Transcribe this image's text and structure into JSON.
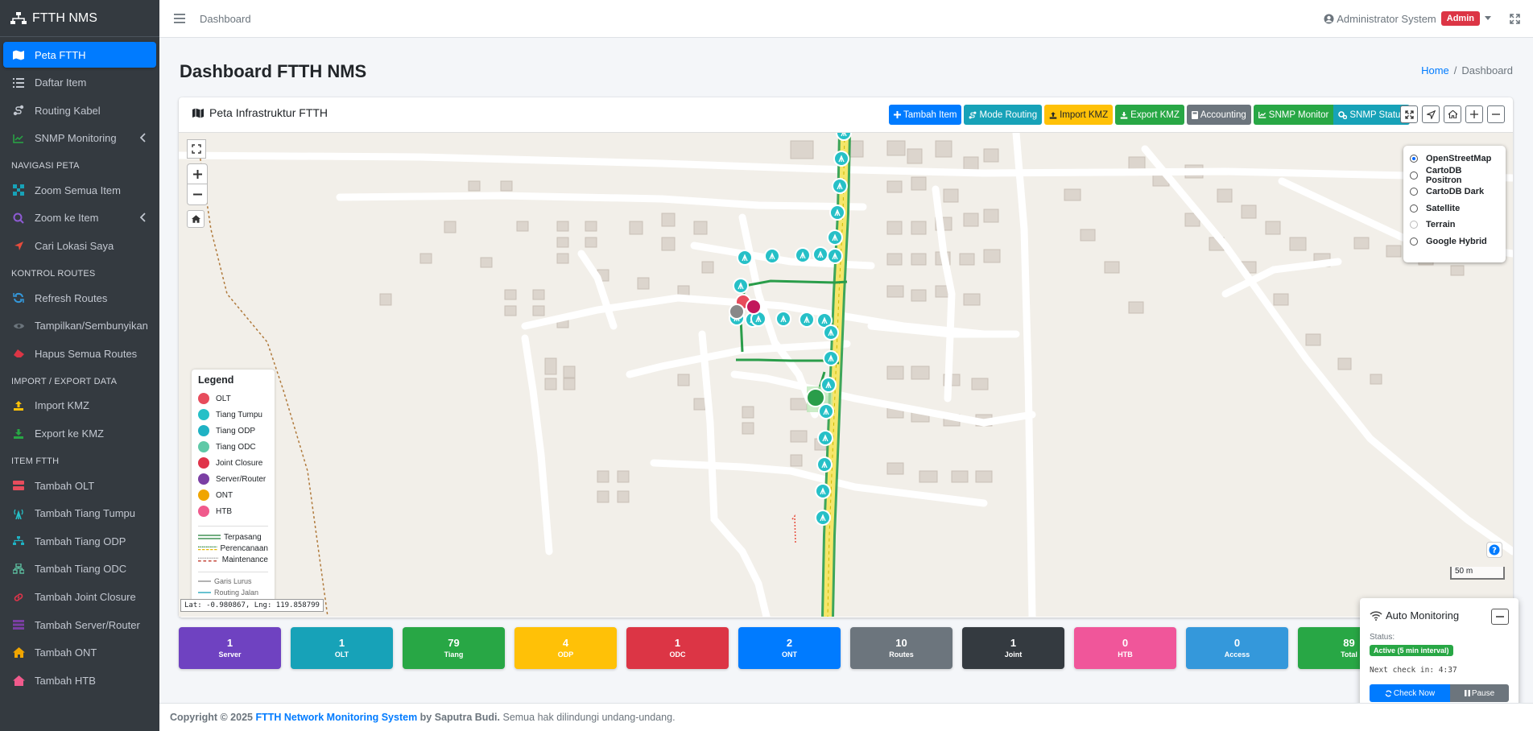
{
  "app": {
    "brand": "FTTH NMS"
  },
  "sidebar": {
    "items": [
      {
        "label": "Peta FTTH",
        "icon": "map-icon",
        "active": true
      },
      {
        "label": "Daftar Item",
        "icon": "list-icon"
      },
      {
        "label": "Routing Kabel",
        "icon": "route-icon"
      },
      {
        "label": "SNMP Monitoring",
        "icon": "chart-line-icon"
      }
    ],
    "header_nav": "NAVIGASI PETA",
    "nav_items": [
      {
        "label": "Zoom Semua Item",
        "icon": "expand-arrows-icon"
      },
      {
        "label": "Zoom ke Item",
        "icon": "search-icon"
      },
      {
        "label": "Cari Lokasi Saya",
        "icon": "location-arrow-icon"
      }
    ],
    "header_routes": "KONTROL ROUTES",
    "route_items": [
      {
        "label": "Refresh Routes",
        "icon": "sync-icon"
      },
      {
        "label": "Tampilkan/Sembunyikan",
        "icon": "eye-icon"
      },
      {
        "label": "Hapus Semua Routes",
        "icon": "eraser-icon"
      }
    ],
    "header_import": "IMPORT / EXPORT DATA",
    "import_items": [
      {
        "label": "Import KMZ",
        "icon": "upload-icon"
      },
      {
        "label": "Export ke KMZ",
        "icon": "download-icon"
      }
    ],
    "header_item": "ITEM FTTH",
    "ftth_items": [
      {
        "label": "Tambah OLT",
        "icon": "server-icon"
      },
      {
        "label": "Tambah Tiang Tumpu",
        "icon": "broadcast-tower-icon"
      },
      {
        "label": "Tambah Tiang ODP",
        "icon": "sitemap-icon"
      },
      {
        "label": "Tambah Tiang ODC",
        "icon": "network-icon"
      },
      {
        "label": "Tambah Joint Closure",
        "icon": "link-icon"
      },
      {
        "label": "Tambah Server/Router",
        "icon": "server-rack-icon"
      },
      {
        "label": "Tambah ONT",
        "icon": "home-icon"
      },
      {
        "label": "Tambah HTB",
        "icon": "house-user-icon"
      }
    ]
  },
  "topbar": {
    "breadcrumb_link": "Dashboard",
    "user_name": "Administrator System",
    "role_badge": "Admin"
  },
  "page": {
    "title": "Dashboard FTTH NMS",
    "breadcrumb_home": "Home",
    "breadcrumb_sep": "/",
    "breadcrumb_current": "Dashboard"
  },
  "card": {
    "title": "Peta Infrastruktur FTTH",
    "buttons": [
      {
        "label": "Tambah Item",
        "color": "#007bff"
      },
      {
        "label": "Mode Routing",
        "color": "#17a2b8"
      },
      {
        "label": "Import KMZ",
        "color": "#ffc107"
      },
      {
        "label": "Export KMZ",
        "color": "#28a745"
      },
      {
        "label": "Accounting",
        "color": "#6c757d"
      },
      {
        "label": "SNMP Monitor",
        "color": "#28a745"
      },
      {
        "label": "SNMP Status",
        "color": "#17a2b8"
      }
    ]
  },
  "map": {
    "layers": [
      {
        "label": "OpenStreetMap",
        "selected": true
      },
      {
        "label": "CartoDB Positron"
      },
      {
        "label": "CartoDB Dark"
      },
      {
        "label": "Satellite"
      },
      {
        "label": "Terrain",
        "disabled": true
      },
      {
        "label": "Google Hybrid"
      }
    ],
    "legend_title": "Legend",
    "legend_items": [
      {
        "label": "OLT",
        "color": "#e74c5c"
      },
      {
        "label": "Tiang Tumpu",
        "color": "#26c0c7"
      },
      {
        "label": "Tiang ODP",
        "color": "#1fb2c4"
      },
      {
        "label": "Tiang ODC",
        "color": "#5fc9a7"
      },
      {
        "label": "Joint Closure",
        "color": "#e0344a"
      },
      {
        "label": "Server/Router",
        "color": "#7b3fa4"
      },
      {
        "label": "ONT",
        "color": "#f0a500"
      },
      {
        "label": "HTB",
        "color": "#f05a8c"
      }
    ],
    "line_legend": [
      {
        "label": "Terpasang",
        "color": "#1e7e34"
      },
      {
        "label": "Perencanaan",
        "color": "#e6b800"
      },
      {
        "label": "Maintenance",
        "color": "#c0392b"
      }
    ],
    "route_legend": [
      {
        "label": "Garis Lurus",
        "color": "#888888"
      },
      {
        "label": "Routing Jalan",
        "color": "#17a2b8"
      }
    ],
    "coords": "Lat: -0.980867, Lng: 119.858799",
    "scale": "50 m"
  },
  "stats": [
    {
      "value": "1",
      "label": "Server",
      "color": "#6f42c1"
    },
    {
      "value": "1",
      "label": "OLT",
      "color": "#17a2b8"
    },
    {
      "value": "79",
      "label": "Tiang",
      "color": "#28a745"
    },
    {
      "value": "4",
      "label": "ODP",
      "color": "#ffc107"
    },
    {
      "value": "1",
      "label": "ODC",
      "color": "#dc3545"
    },
    {
      "value": "2",
      "label": "ONT",
      "color": "#007bff"
    },
    {
      "value": "10",
      "label": "Routes",
      "color": "#6c757d"
    },
    {
      "value": "1",
      "label": "Joint",
      "color": "#343a40"
    },
    {
      "value": "0",
      "label": "HTB",
      "color": "#f0569a"
    },
    {
      "value": "0",
      "label": "Access",
      "color": "#3498db"
    },
    {
      "value": "89",
      "label": "Total",
      "color": "#28a745"
    }
  ],
  "monitor": {
    "title": "Auto Monitoring",
    "status_label": "Status:",
    "status_badge": "Active (5 min interval)",
    "next_check": "Next check in: 4:37",
    "check_now": "Check Now",
    "pause": "Pause"
  },
  "footer": {
    "copyright": "Copyright © 2025",
    "system": "FTTH Network Monitoring System",
    "by": "by Saputra Budi.",
    "rights": "Semua hak dilindungi undang-undang."
  }
}
